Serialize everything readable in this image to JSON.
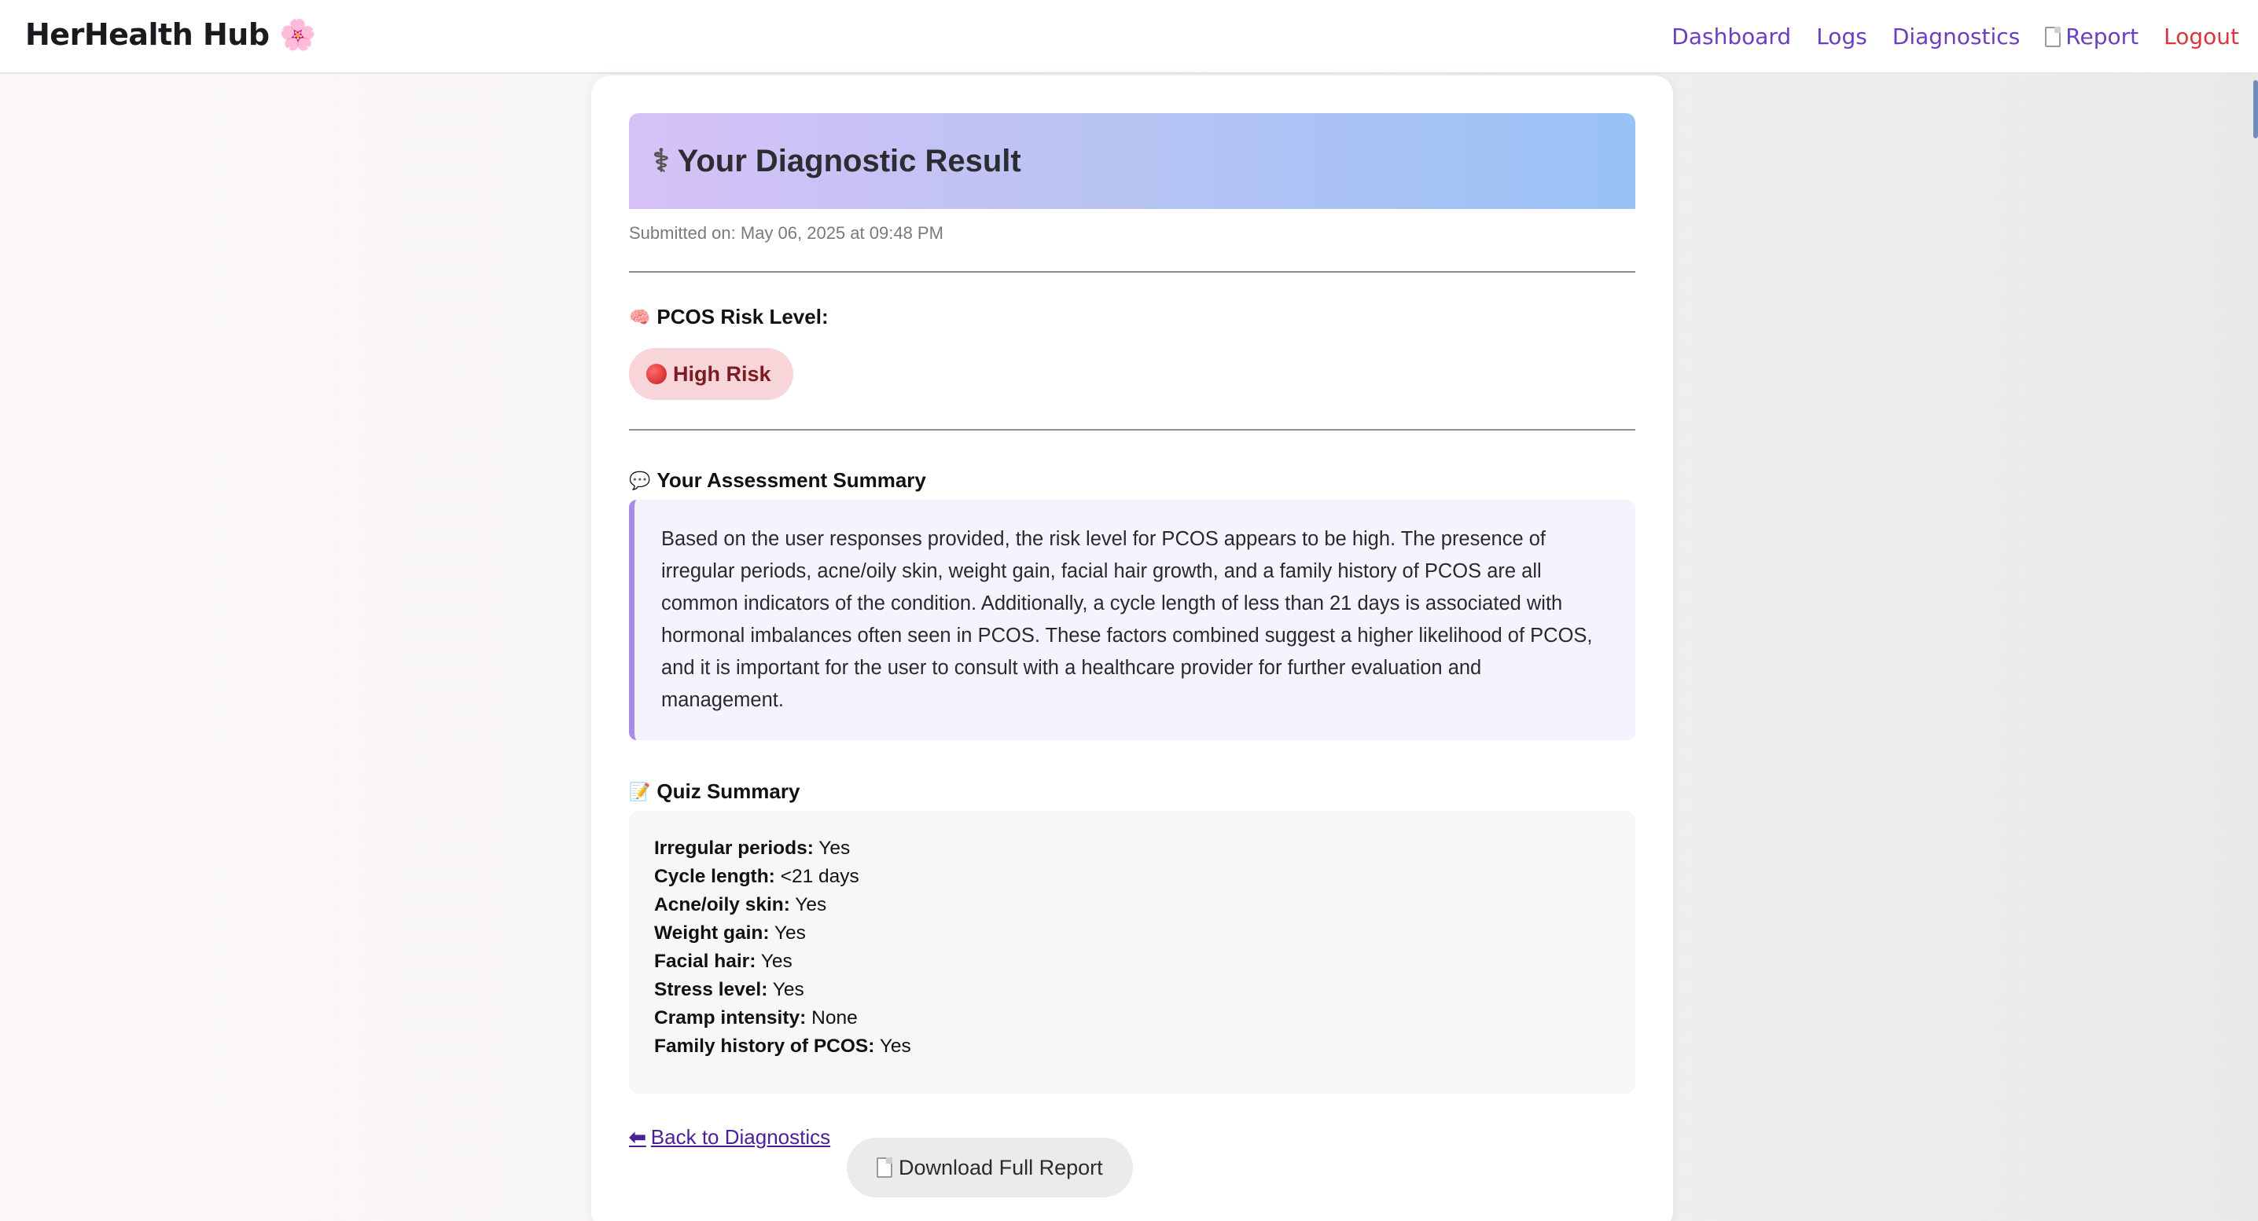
{
  "nav": {
    "brand": "HerHealth Hub",
    "brand_icon": "🌸",
    "links": {
      "dashboard": "Dashboard",
      "logs": "Logs",
      "diagnostics": "Diagnostics",
      "report": "Report",
      "logout": "Logout"
    },
    "link_color": "#6b3fc1",
    "logout_color": "#d9363e"
  },
  "result": {
    "title": "Your Diagnostic Result",
    "title_icon": "stethoscope-icon",
    "submitted": "Submitted on: May 06, 2025 at 09:48 PM"
  },
  "risk": {
    "label": "PCOS Risk Level:",
    "label_icon": "brain-icon",
    "badge": "High Risk",
    "badge_color": "#f7d5d8"
  },
  "assessment": {
    "label": "Your Assessment Summary",
    "label_icon": "speech-bubble-icon",
    "text": "Based on the user responses provided, the risk level for PCOS appears to be high. The presence of irregular periods, acne/oily skin, weight gain, facial hair growth, and a family history of PCOS are all common indicators of the condition. Additionally, a cycle length of less than 21 days is associated with hormonal imbalances often seen in PCOS. These factors combined suggest a higher likelihood of PCOS, and it is important for the user to consult with a healthcare provider for further evaluation and management."
  },
  "quiz": {
    "label": "Quiz Summary",
    "label_icon": "memo-icon",
    "items": [
      {
        "key": "Irregular periods:",
        "value": "Yes"
      },
      {
        "key": "Cycle length:",
        "value": "<21 days"
      },
      {
        "key": "Acne/oily skin:",
        "value": "Yes"
      },
      {
        "key": "Weight gain:",
        "value": "Yes"
      },
      {
        "key": "Facial hair:",
        "value": "Yes"
      },
      {
        "key": "Stress level:",
        "value": "Yes"
      },
      {
        "key": "Cramp intensity:",
        "value": "None"
      },
      {
        "key": "Family history of PCOS:",
        "value": "Yes"
      }
    ]
  },
  "actions": {
    "back": "Back to Diagnostics",
    "download": "Download Full Report"
  }
}
